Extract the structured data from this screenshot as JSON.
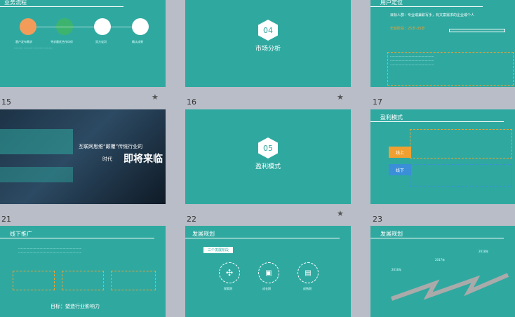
{
  "slides": {
    "s14": {
      "title": "业务流程",
      "steps": [
        "客户发布需求",
        "寻求最优合作伙伴",
        "双方谈判",
        "确认成果"
      ]
    },
    "s15": {
      "number": "15",
      "section_no": "04",
      "section_title": "市场分析"
    },
    "s16": {
      "number": "16",
      "title": "用户定位",
      "target": "目标人群：专业或兼职写手，有文案需求的企业或个人",
      "age_label": "年龄阶段：25岁-35岁"
    },
    "s17": {
      "number": "17",
      "banner_line1": "互联网思维“颠覆”传统行业的",
      "banner_line2": "时代",
      "banner_big": "即将来临"
    },
    "s21": {
      "number": "21",
      "section_no": "05",
      "section_title": "盈利模式"
    },
    "s22": {
      "number": "22",
      "title": "盈利模式",
      "online": "线上",
      "offline": "线下"
    },
    "s23": {
      "number": "23"
    },
    "s24": {
      "title": "线下推广",
      "goal": "目标：塑造行业影响力"
    },
    "s25": {
      "title": "发展规划",
      "phase_label": "三个发展阶段",
      "phases": [
        "探索期",
        "成长期",
        "成熟期"
      ]
    },
    "s26": {
      "title": "发展规划",
      "years": [
        "2016年",
        "2017年",
        "2018年"
      ]
    }
  },
  "colors": {
    "teal": "#2fa9a0",
    "orange": "#f0a030",
    "blue": "#3a8fd8",
    "gray_bg": "#b9bdc7"
  },
  "icons": {
    "star": "star-icon"
  }
}
